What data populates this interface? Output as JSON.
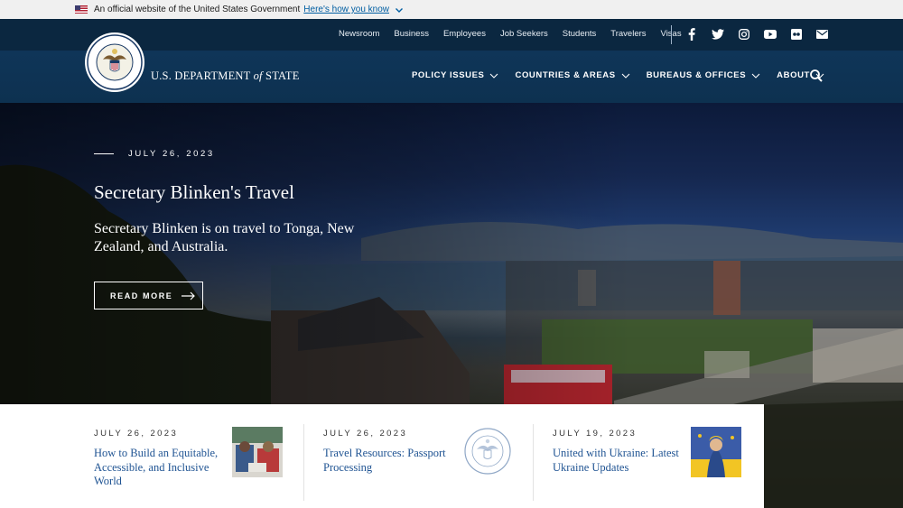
{
  "gov_banner": {
    "text": "An official website of the United States Government",
    "link": "Here's how you know"
  },
  "utility_nav": [
    "Newsroom",
    "Business",
    "Employees",
    "Job Seekers",
    "Students",
    "Travelers",
    "Visas"
  ],
  "social_icons": [
    "facebook-icon",
    "twitter-icon",
    "instagram-icon",
    "youtube-icon",
    "flickr-icon",
    "email-icon"
  ],
  "brand": {
    "pre": "U.S. DEPARTMENT",
    "of": "of",
    "post": "STATE"
  },
  "main_nav": [
    "POLICY ISSUES",
    "COUNTRIES & AREAS",
    "BUREAUS & OFFICES",
    "ABOUT"
  ],
  "hero": {
    "date": "JULY 26, 2023",
    "title": "Secretary Blinken's Travel",
    "description": "Secretary Blinken is on travel to Tonga, New Zealand, and Australia.",
    "button": "READ MORE"
  },
  "cards": [
    {
      "date": "JULY 26, 2023",
      "title": "How to Build an Equitable, Accessible, and Inclusive World"
    },
    {
      "date": "JULY 26, 2023",
      "title": "Travel Resources: Passport Processing"
    },
    {
      "date": "JULY 19, 2023",
      "title": "United with Ukraine: Latest Ukraine Updates"
    }
  ],
  "colors": {
    "header": "#0f3558",
    "link": "#205493",
    "banner": "#f0f0f0"
  }
}
